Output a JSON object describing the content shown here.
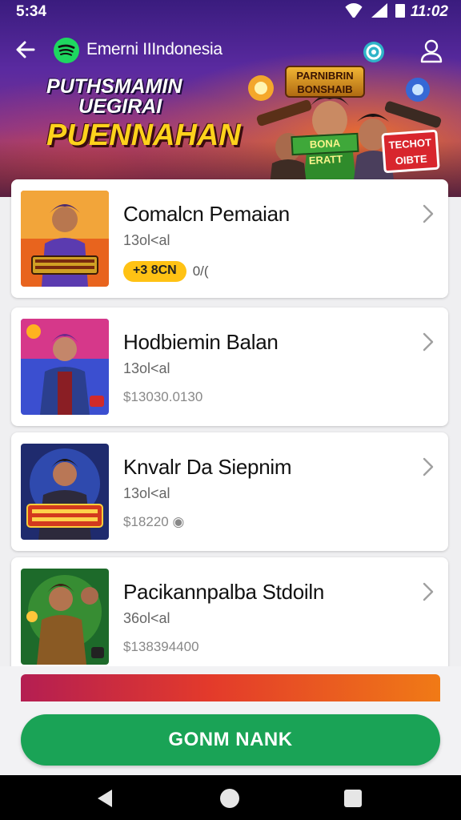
{
  "status_bar": {
    "time": "5:34",
    "clock": "11:02"
  },
  "app_bar": {
    "title": "Emerni IIIndonesia"
  },
  "banner": {
    "headline_line1": "PUTHSMAMIN",
    "headline_line2": "UEGIRAI",
    "headline_line3": "PUENNAHAN",
    "logo_text": "PARNIBRIN BONSHAIB",
    "tag_text": "BONA ERATT",
    "badge_text": "TECHOT OIBTE"
  },
  "items": [
    {
      "title": "Comalcn Pemaian",
      "count": "13ol<al",
      "meta_pill": "+3 8CN",
      "meta_suffix": "0/(",
      "price": ""
    },
    {
      "title": "Hodbiemin Balan",
      "count": "13ol<al",
      "meta_pill": "",
      "meta_suffix": "",
      "price": "$13030.0130"
    },
    {
      "title": "Knvalr Da Siepnim",
      "count": "13ol<al",
      "meta_pill": "",
      "meta_suffix": "",
      "price": "$18220 ◉"
    },
    {
      "title": "Pacikannpalba Stdoiln",
      "count": "36ol<al",
      "meta_pill": "",
      "meta_suffix": "",
      "price": "$138394400"
    }
  ],
  "cta": {
    "label": "GONM NANK"
  },
  "colors": {
    "accent_green": "#1aa356",
    "pill_yellow": "#ffc214",
    "banner_purple": "#3a1c7e"
  }
}
